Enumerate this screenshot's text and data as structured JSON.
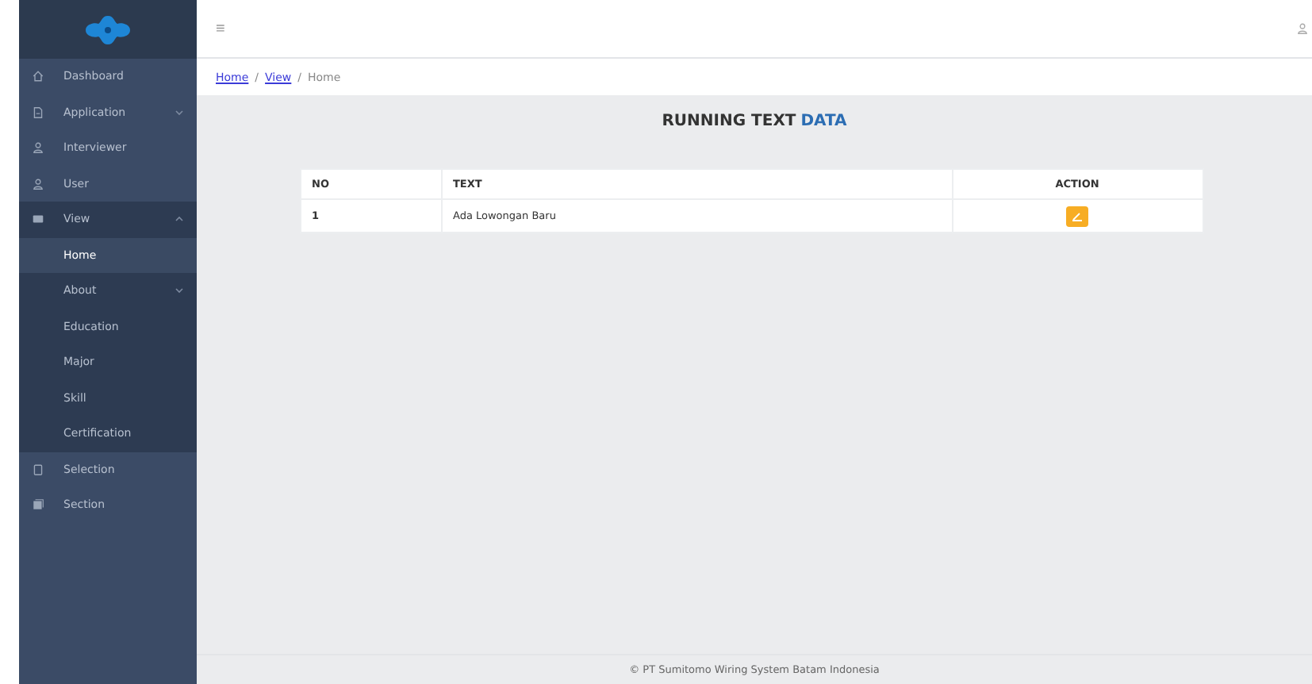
{
  "sidebar": {
    "items": [
      {
        "label": "Dashboard",
        "expandable": false,
        "expanded": false
      },
      {
        "label": "Application",
        "expandable": true,
        "expanded": false
      },
      {
        "label": "Interviewer",
        "expandable": false,
        "expanded": false
      },
      {
        "label": "User",
        "expandable": false,
        "expanded": false
      },
      {
        "label": "View",
        "expandable": true,
        "expanded": true,
        "children": [
          {
            "label": "Home",
            "selected": true,
            "expandable": false
          },
          {
            "label": "About",
            "selected": false,
            "expandable": true
          },
          {
            "label": "Education",
            "selected": false,
            "expandable": false
          },
          {
            "label": "Major",
            "selected": false,
            "expandable": false
          },
          {
            "label": "Skill",
            "selected": false,
            "expandable": false
          },
          {
            "label": "Certification",
            "selected": false,
            "expandable": false
          }
        ]
      },
      {
        "label": "Selection",
        "expandable": false,
        "expanded": false
      },
      {
        "label": "Section",
        "expandable": false,
        "expanded": false
      }
    ]
  },
  "topbar": {
    "menu_glyph": "≡"
  },
  "breadcrumb": [
    {
      "label": "Home",
      "kind": "link"
    },
    {
      "label": "/",
      "kind": "separator"
    },
    {
      "label": "View",
      "kind": "link"
    },
    {
      "label": "/",
      "kind": "separator"
    },
    {
      "label": "Home",
      "kind": "current"
    }
  ],
  "title": {
    "main": "RUNNING TEXT",
    "accent": "DATA"
  },
  "table": {
    "columns": [
      "NO",
      "TEXT",
      "ACTION"
    ],
    "rows": [
      {
        "no": "1",
        "text": "Ada Lowongan Baru"
      }
    ]
  },
  "footer": "© PT Sumitomo Wiring System Batam Indonesia"
}
